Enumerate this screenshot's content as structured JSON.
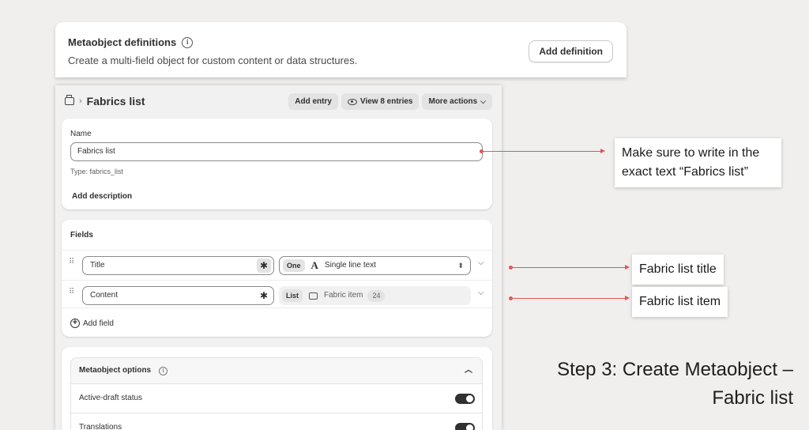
{
  "definitions_header": {
    "title": "Metaobject definitions",
    "info_icon": "info-icon",
    "subtitle": "Create a multi-field object for custom content or data structures.",
    "add_button": "Add definition"
  },
  "editor": {
    "breadcrumb_icon": "metaobject-icon",
    "breadcrumb": "Fabrics list",
    "actions": {
      "add_entry": "Add entry",
      "view_entries": "View 8 entries",
      "more_actions": "More actions"
    },
    "name_card": {
      "label": "Name",
      "value": "Fabrics list",
      "type_hint": "Type: fabrics_list",
      "add_description": "Add description"
    },
    "fields_card": {
      "title": "Fields",
      "rows": [
        {
          "name": "Title",
          "required": true,
          "cardinality": "One",
          "type_icon": "text-icon",
          "type": "Single line text"
        },
        {
          "name": "Content",
          "required": false,
          "cardinality": "List",
          "type_icon": "reference-icon",
          "type": "Fabric item",
          "count": "24"
        }
      ],
      "add_field": "Add field"
    },
    "options_card": {
      "title": "Metaobject options",
      "options": [
        {
          "label": "Active-draft status",
          "enabled": true
        },
        {
          "label": "Translations",
          "enabled": true
        }
      ]
    }
  },
  "annotations": {
    "name_note": "Make sure to write in the exact text “Fabrics list”",
    "title_note": "Fabric list title",
    "item_note": "Fabric list item",
    "step_title": "Step 3: Create Metaobject – Fabric list"
  },
  "colors": {
    "background": "#f0efed",
    "arrow": "#e0565b",
    "card": "#ffffff",
    "text": "#303030"
  }
}
